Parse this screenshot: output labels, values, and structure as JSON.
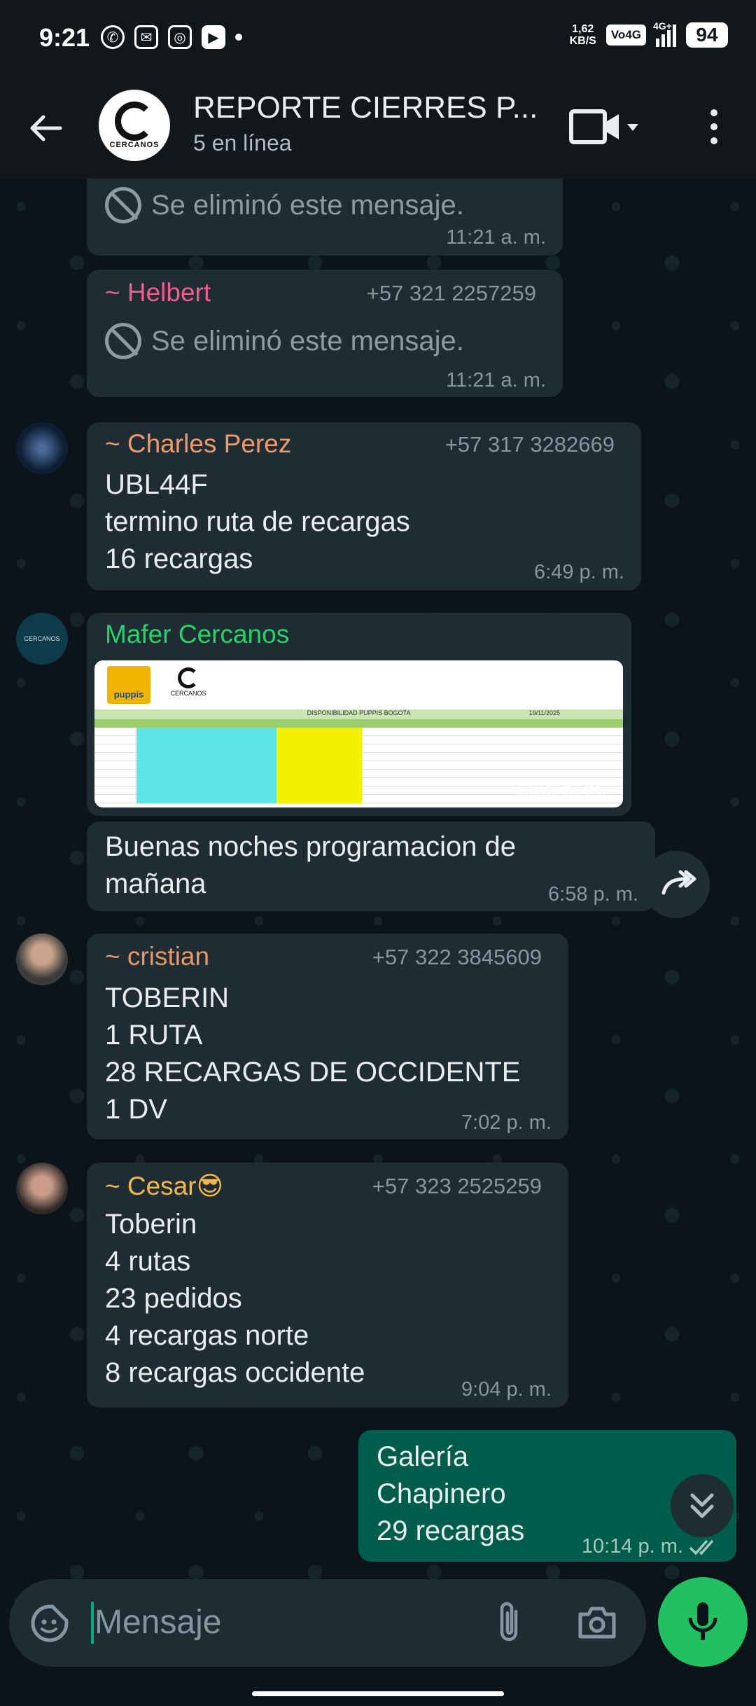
{
  "status_bar": {
    "time": "9:21",
    "speed_value": "1,62",
    "speed_unit": "KB/S",
    "volte": "Vo4G",
    "network": "4G+",
    "battery": "94"
  },
  "header": {
    "group_name": "REPORTE CIERRES P...",
    "subtitle": "5 en línea",
    "avatar_text": "CERCANOS"
  },
  "messages": [
    {
      "type": "deleted",
      "text": "Se eliminó este mensaje.",
      "time": "11:21 a. m."
    },
    {
      "type": "deleted",
      "sender": "~ Helbert",
      "phone": "+57 321 2257259",
      "text": "Se eliminó este mensaje.",
      "time": "11:21 a. m."
    },
    {
      "type": "text",
      "sender": "~ Charles Perez",
      "phone": "+57 317 3282669",
      "text": "UBL44F\ntermino ruta de recargas\n16 recargas",
      "time": "6:49 p. m."
    },
    {
      "type": "image",
      "sender": "Mafer Cercanos",
      "time": "6:58 p. m.",
      "image": {
        "brand": "puppis",
        "logo2": "CERCANOS",
        "sheet_title": "DISPONIBILIDAD PUPPIS BOGOTA",
        "sheet_date": "19/11/2025"
      }
    },
    {
      "type": "text",
      "text": "Buenas noches programacion de\nmañana",
      "time": "6:58 p. m."
    },
    {
      "type": "text",
      "sender": "~ cristian",
      "phone": "+57 322 3845609",
      "text": "TOBERIN\n1 RUTA\n28 RECARGAS DE OCCIDENTE\n1 DV",
      "time": "7:02 p. m."
    },
    {
      "type": "text",
      "sender": "~ Cesar😎",
      "phone": "+57 323 2525259",
      "text": "Toberin\n4 rutas\n23 pedidos\n4 recargas norte\n8 recargas occidente",
      "time": "9:04 p. m."
    },
    {
      "type": "outgoing",
      "text": "Galería\nChapinero\n29 recargas",
      "time": "10:14 p. m."
    }
  ],
  "composer": {
    "placeholder": "Mensaje"
  },
  "colors": {
    "helbert": "#f15c8b",
    "charles": "#ef9a6d",
    "mafer": "#53bdeb",
    "mafer_name": "#25d366",
    "cristian": "#e59a66",
    "cesar": "#f2b84b",
    "accent": "#21c063",
    "outgoing": "#005c4b"
  }
}
